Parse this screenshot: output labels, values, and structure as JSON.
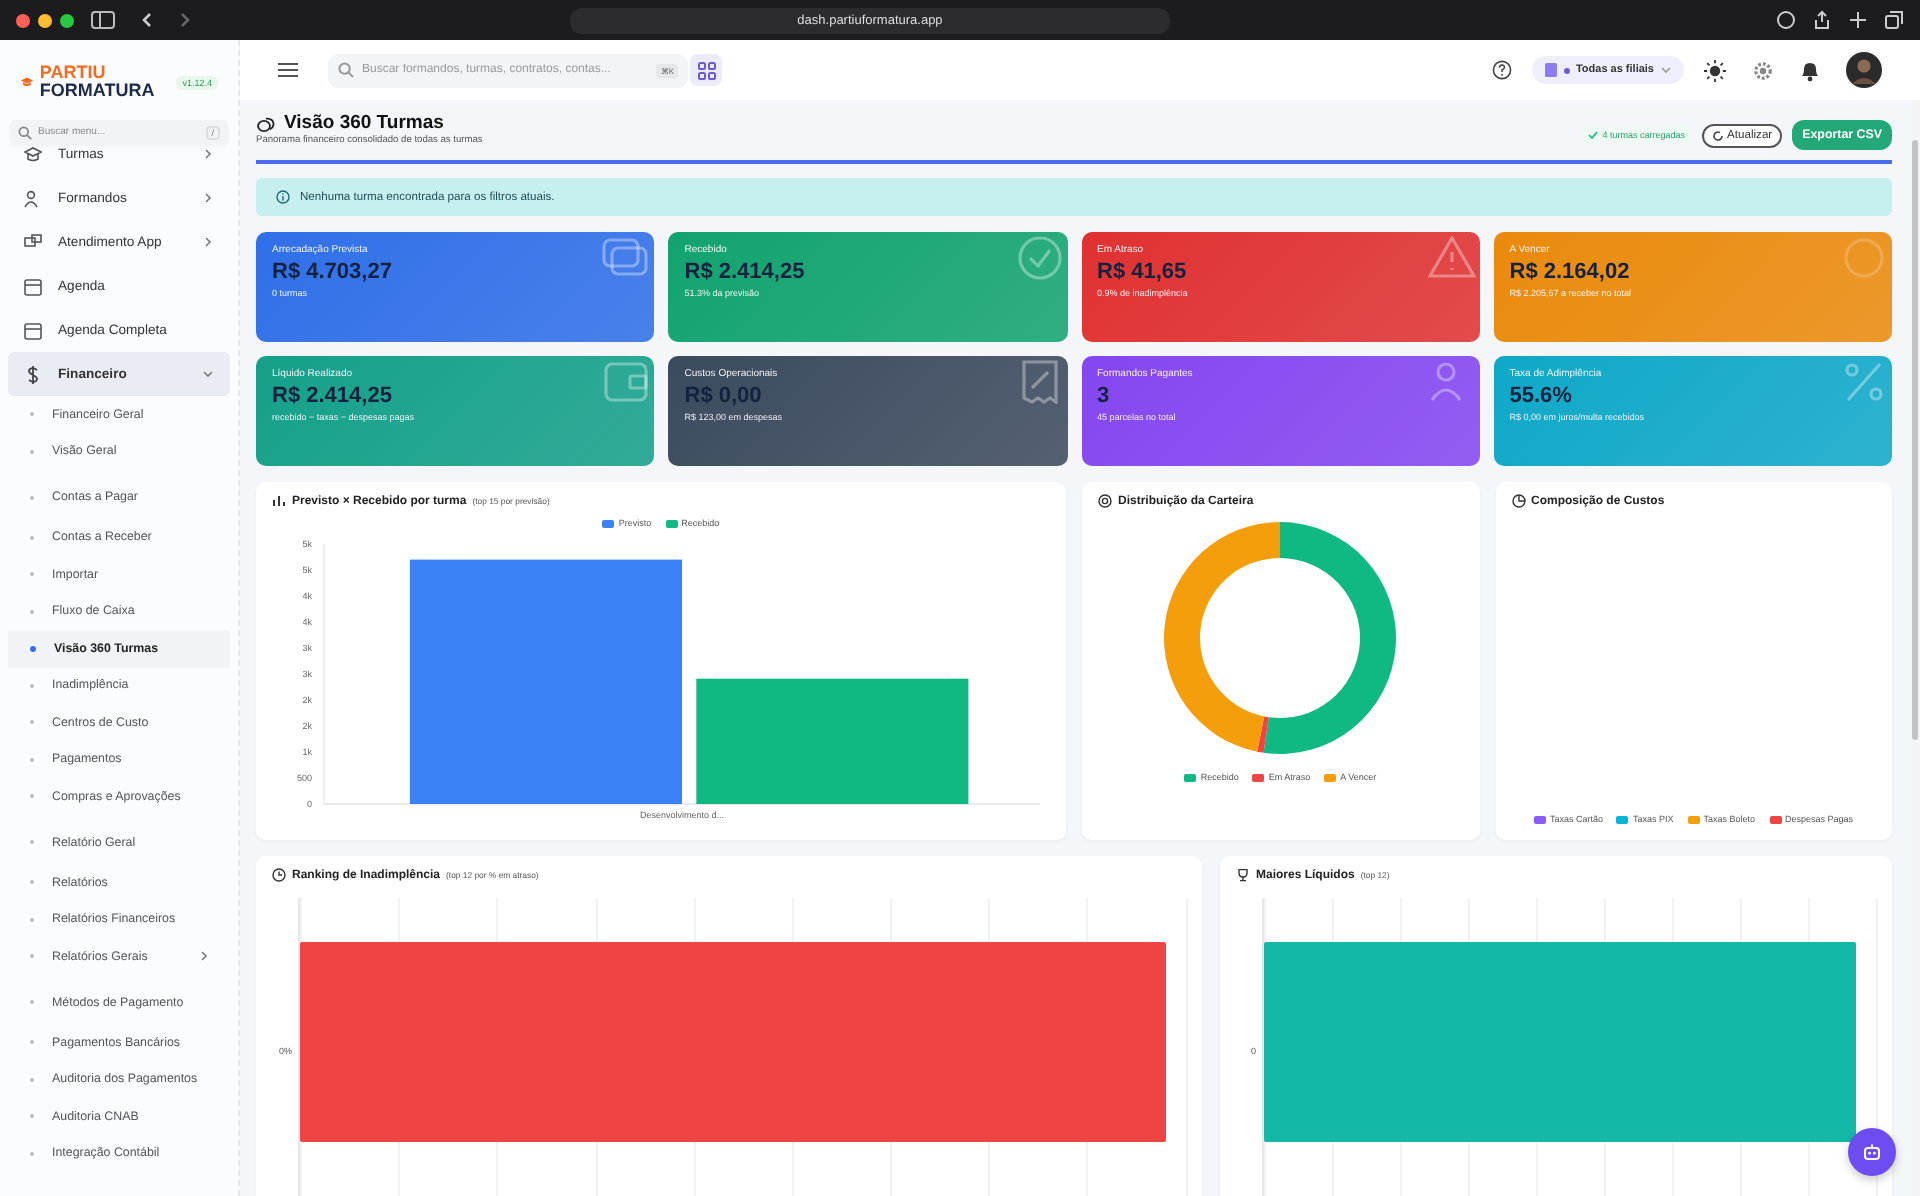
{
  "browser": {
    "url": "dash.partiuformatura.app"
  },
  "sidebar": {
    "logo_top": "PARTIU",
    "logo_bottom": "FORMATURA",
    "version": "v1.12.4",
    "search": {
      "placeholder": "Buscar menu...",
      "shortcut": "/"
    },
    "items": [
      {
        "label": "Turmas",
        "expandable": true,
        "expanded": false,
        "selected": false
      },
      {
        "label": "Formandos",
        "expandable": true,
        "expanded": false,
        "selected": false
      },
      {
        "label": "Atendimento App",
        "expandable": true,
        "expanded": false,
        "selected": false
      },
      {
        "label": "Agenda",
        "expandable": false,
        "expanded": false,
        "selected": false
      },
      {
        "label": "Agenda Completa",
        "expandable": false,
        "expanded": false,
        "selected": false
      },
      {
        "label": "Financeiro",
        "expandable": true,
        "expanded": true,
        "selected": true,
        "children": [
          {
            "label": "Financeiro Geral",
            "gap_above": false,
            "expandable": false,
            "selected": false
          },
          {
            "label": "Visão Geral",
            "gap_above": false,
            "expandable": false,
            "selected": false
          },
          {
            "label": "Contas a Pagar",
            "gap_above": true,
            "expandable": false,
            "selected": false
          },
          {
            "label": "Contas a Receber",
            "gap_above": false,
            "expandable": false,
            "selected": false
          },
          {
            "label": "Importar",
            "gap_above": false,
            "expandable": false,
            "selected": false
          },
          {
            "label": "Fluxo de Caixa",
            "gap_above": false,
            "expandable": false,
            "selected": false
          },
          {
            "label": "Visão 360 Turmas",
            "gap_above": false,
            "expandable": false,
            "selected": true
          },
          {
            "label": "Inadimplência",
            "gap_above": false,
            "expandable": false,
            "selected": false
          },
          {
            "label": "Centros de Custo",
            "gap_above": false,
            "expandable": false,
            "selected": false
          },
          {
            "label": "Pagamentos",
            "gap_above": false,
            "expandable": false,
            "selected": false
          },
          {
            "label": "Compras e Aprovações",
            "gap_above": false,
            "expandable": false,
            "selected": false
          },
          {
            "label": "Relatório Geral",
            "gap_above": true,
            "expandable": false,
            "selected": false
          },
          {
            "label": "Relatórios",
            "gap_above": false,
            "expandable": false,
            "selected": false
          },
          {
            "label": "Relatórios Financeiros",
            "gap_above": false,
            "expandable": false,
            "selected": false
          },
          {
            "label": "Relatórios Gerais",
            "gap_above": false,
            "expandable": true,
            "selected": false
          },
          {
            "label": "Métodos de Pagamento",
            "gap_above": true,
            "expandable": false,
            "selected": false
          },
          {
            "label": "Pagamentos Bancários",
            "gap_above": false,
            "expandable": false,
            "selected": false
          },
          {
            "label": "Auditoria dos Pagamentos",
            "gap_above": false,
            "expandable": false,
            "selected": false
          },
          {
            "label": "Auditoria CNAB",
            "gap_above": false,
            "expandable": false,
            "selected": false
          },
          {
            "label": "Integração Contábil",
            "gap_above": false,
            "expandable": false,
            "selected": false
          }
        ]
      }
    ]
  },
  "header": {
    "search": {
      "placeholder": "Buscar formandos, turmas, contratos, contas...",
      "shortcut": "⌘K"
    },
    "branch": "Todas as filiais"
  },
  "page": {
    "title": "Visão 360 Turmas",
    "subtitle": "Panorama financeiro consolidado de todas as turmas",
    "status": "4 turmas carregadas",
    "refresh": "Atualizar",
    "export": "Exportar CSV",
    "progress": {
      "level": 1
    }
  },
  "alert": "Nenhuma turma encontrada para os filtros atuais.",
  "cards": [
    {
      "label": "Arrecadação Prevista",
      "value": "R$ 4.703,27",
      "note": "0 turmas",
      "color": "#2f6fe8"
    },
    {
      "label": "Recebido",
      "value": "R$ 2.414,25",
      "note": "51.3% da previsão",
      "color": "#12a36f"
    },
    {
      "label": "Em Atraso",
      "value": "R$ 41,65",
      "note": "0.9% de inadimplência",
      "color": "#e03131"
    },
    {
      "label": "A Vencer",
      "value": "R$ 2.164,02",
      "note": "R$ 2.205,67 a receber no total",
      "color": "#ea8a0c"
    },
    {
      "label": "Líquido Realizado",
      "value": "R$ 2.414,25",
      "note": "recebido − taxas − despesas pagas",
      "color": "#14a08a"
    },
    {
      "label": "Custos Operacionais",
      "value": "R$ 0,00",
      "note": "R$ 123,00 em despesas",
      "color": "#3c4a5e"
    },
    {
      "label": "Formandos Pagantes",
      "value": "3",
      "note": "45 parcelas no total",
      "color": "#8446f0"
    },
    {
      "label": "Taxa de Adimplência",
      "value": "55.6%",
      "note": "R$ 0,00 em juros/multa recebidos",
      "color": "#0fa8c8"
    }
  ],
  "previsto_recebido": {
    "title": "Previsto × Recebido por turma",
    "hint": "(top 15 por previsão)",
    "chart_data": {
      "type": "bar",
      "categories": [
        "Desenvolvimento d..."
      ],
      "series": [
        {
          "name": "Previsto",
          "color": "#3b82f6",
          "values": [
            4700
          ]
        },
        {
          "name": "Recebido",
          "color": "#10b981",
          "values": [
            2410
          ]
        }
      ],
      "ylim": [
        0,
        5000
      ],
      "yticks": [
        {
          "value": 0,
          "label": "0"
        },
        {
          "value": 500,
          "label": "500"
        },
        {
          "value": 1000,
          "label": "1k"
        },
        {
          "value": 1500,
          "label": "2k"
        },
        {
          "value": 2000,
          "label": "2k"
        },
        {
          "value": 2500,
          "label": "3k"
        },
        {
          "value": 3000,
          "label": "3k"
        },
        {
          "value": 3500,
          "label": "4k"
        },
        {
          "value": 4000,
          "label": "4k"
        },
        {
          "value": 4500,
          "label": "5k"
        },
        {
          "value": 5000,
          "label": "5k"
        }
      ]
    }
  },
  "distribuicao": {
    "title": "Distribuição da Carteira",
    "chart_data": {
      "type": "donut",
      "categories": [
        "Recebido",
        "Em Atraso",
        "A Vencer"
      ],
      "values": [
        52.26,
        0.9,
        46.84
      ],
      "colors": [
        "#10b981",
        "#ef4444",
        "#f59e0b"
      ]
    }
  },
  "custos": {
    "title": "Composição de Custos",
    "legend": [
      {
        "label": "Taxas Cartão",
        "color": "#8b5cf6"
      },
      {
        "label": "Taxas PIX",
        "color": "#06b6d4"
      },
      {
        "label": "Taxas Boleto",
        "color": "#f59e0b"
      },
      {
        "label": "Despesas Pagas",
        "color": "#ef4444"
      }
    ]
  },
  "ranking": {
    "title": "Ranking de Inadimplência",
    "hint": "(top 12 por % em atraso)",
    "axis_label": "0%",
    "color": "#ef4444"
  },
  "maiores": {
    "title": "Maiores Líquidos",
    "hint": "(top 12)",
    "axis_label": "0",
    "color": "#14b8a6"
  }
}
